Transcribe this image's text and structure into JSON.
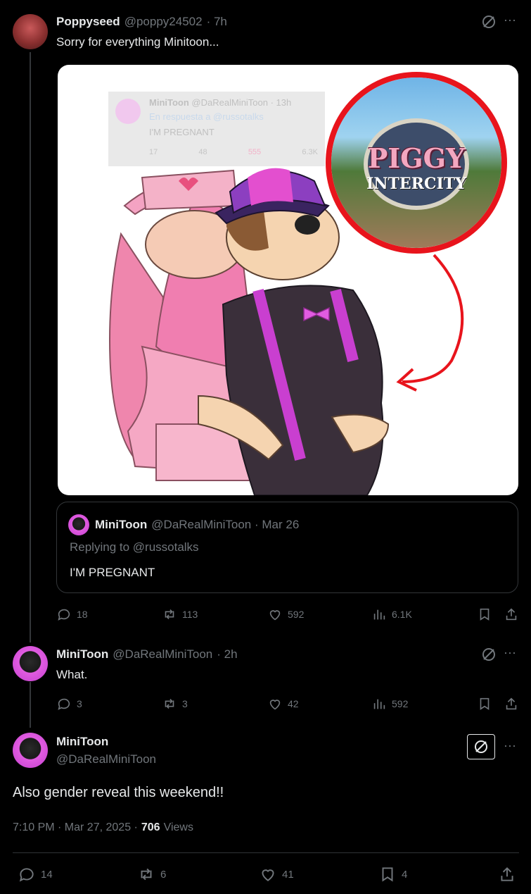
{
  "tweet1": {
    "name": "Poppyseed",
    "handle": "@poppy24502",
    "time": "· 7h",
    "text": "Sorry for everything Minitoon...",
    "image_header": {
      "name": "MiniToon",
      "handle": "@DaRealMiniToon · 13h",
      "reply_line": "En respuesta a @russotalks",
      "text": "I'M PREGNANT",
      "stats": [
        "17",
        "48",
        "555",
        "6.3K"
      ]
    },
    "image_logo_line1": "PIGGY",
    "image_logo_line2": "INTERCITY",
    "quote": {
      "name": "MiniToon",
      "handle": "@DaRealMiniToon · Mar 26",
      "replying": "Replying to @russotalks",
      "text": "I'M PREGNANT"
    },
    "stats": {
      "replies": "18",
      "reposts": "113",
      "likes": "592",
      "views": "6.1K"
    }
  },
  "tweet2": {
    "name": "MiniToon",
    "handle": "@DaRealMiniToon",
    "time": "· 2h",
    "text": "What.",
    "stats": {
      "replies": "3",
      "reposts": "3",
      "likes": "42",
      "views": "592"
    }
  },
  "tweet3": {
    "name": "MiniToon",
    "handle": "@DaRealMiniToon",
    "text": "Also gender reveal this weekend!!",
    "meta_time": "7:10 PM · Mar 27, 2025 ·",
    "meta_views_count": "706",
    "meta_views_label": "Views",
    "stats": {
      "replies": "14",
      "reposts": "6",
      "likes": "41",
      "bookmarks": "4"
    }
  },
  "more_label": "···",
  "colors": {
    "accent": "#e7e9ea",
    "muted": "#71767b",
    "border": "#333639",
    "red": "#e8141c"
  }
}
